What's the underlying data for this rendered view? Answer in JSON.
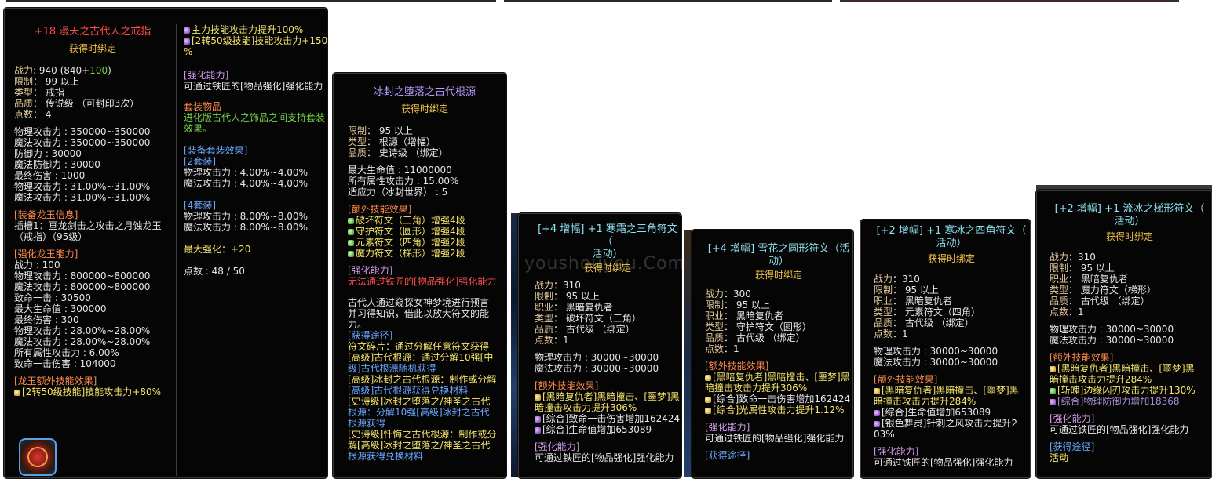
{
  "tooltip1": {
    "title": "+18 漫天之古代人之戒指",
    "bind": "获得时绑定",
    "basic": [
      {
        "k": "战力",
        "v": ": 940 (840+",
        "extra": "100",
        ")": ")"
      },
      {
        "k": "限制",
        "v": "：  99 以上"
      },
      {
        "k": "类型",
        "v": "：  戒指"
      },
      {
        "k": "品质",
        "v": "：  传说级           （可封印3次）"
      },
      {
        "k": "点数",
        "v": "：  4"
      }
    ],
    "stats": [
      "物理攻击力 : 350000~350000",
      "魔法攻击力 : 350000~350000",
      "防御力 : 30000",
      "魔法防御力 : 30000",
      "最终伤害 : 1000",
      "物理攻击力 : 31.00%~31.00%",
      "魔法攻击力 : 31.00%~31.00%"
    ],
    "gem_head": "[装备龙玉信息]",
    "gem_lines": [
      "插槽1：亘龙剑击之攻击之月蚀龙玉",
      "（戒指）（95级）"
    ],
    "enhance_head": "[强化龙玉能力]",
    "enhance_lines": [
      "战力 : 100",
      "物理攻击力 : 800000~800000",
      "魔法攻击力 : 800000~800000",
      "致命一击 : 30500",
      "最大生命值 :  300000",
      "最终伤害 : 300",
      "物理攻击力 : 28.00%~28.00%",
      "魔法攻击力 : 28.00%~28.00%",
      "所有属性攻击力 : 6.00%",
      "致命一击伤害 : 104000"
    ],
    "extra_head": "[龙玉额外技能效果]",
    "extra_line": "[2转50级技能]技能攻击力+80%",
    "right_top": [
      "主力技能攻击力提升100%",
      "[2转50级技能]技能攻击力+150",
      "%"
    ],
    "right_enh_head": "[强化能力]",
    "right_enh_line": "可通过铁匠的[物品强化]强化能力",
    "set_item_head": "套装物品",
    "set_item_desc": [
      "进化版古代人之饰品之间支持套装",
      "效果。"
    ],
    "set_effect_head": "[装备套装效果]",
    "set2_head": "[2套装]",
    "set2_lines": [
      "物理攻击力 : 4.00%~4.00%",
      "魔法攻击力 : 4.00%~4.00%"
    ],
    "set4_head": "[4套装]",
    "set4_lines": [
      "物理攻击力 : 8.00%~8.00%",
      "魔法攻击力 : 8.00%~8.00%"
    ],
    "max_enh": "最大强化：+20",
    "points": "点数 : 48 / 50"
  },
  "tooltip2": {
    "title": "冰封之堕落之古代根源",
    "bind": "获得时绑定",
    "basic": [
      {
        "k": "限制",
        "v": "：  95 以上"
      },
      {
        "k": "类型",
        "v": "：  根源（增幅）"
      },
      {
        "k": "品质",
        "v": "：  史诗级                    （绑定）"
      }
    ],
    "stats": [
      "最大生命值 :  11000000",
      "所有属性攻击力 : 15.00%",
      "适应力（冰封世界） : 5"
    ],
    "skill_head": "[额外技能效果]",
    "skills": [
      "破坏符文（三角）增强4段",
      "守护符文（圆形）增强4段",
      "元素符文（四角）增强2段",
      "魔力符文（梯形）增强2段"
    ],
    "enh_head": "[强化能力]",
    "enh_line": "无法通过铁匠的[物品强化]强化能力",
    "desc": [
      "古代人通过窥探女神梦境进行预言",
      "并习得知识，借此以放大符文的能",
      "力。"
    ],
    "route_head": "[获得途径]",
    "routes": [
      "符文碎片：通过分解任意符文获得",
      "[高级]古代根源：通过分解10强[中",
      "级]古代根源随机获得",
      "[高级]冰封之古代根源：制作或分解",
      "[高级]古代根源获得兑换材料",
      "[史诗级]冰封之堕落之/神圣之古代",
      "根源：分解10强[高级]冰封之古代",
      "根源获得",
      "[史诗级]忏悔之古代根源：制作或分",
      "解[高级]冰封之堕落之/神圣之古代",
      "根源获得兑换材料"
    ]
  },
  "tooltip3": {
    "title": [
      "[+4 增幅] +1  寒霜之三角符文（",
      "活动）"
    ],
    "bind": "获得时绑定",
    "basic": [
      {
        "k": "战力",
        "v": "：310"
      },
      {
        "k": "限制",
        "v": "：  95 以上"
      },
      {
        "k": "职业",
        "v": "：  黑暗复仇者"
      },
      {
        "k": "类型",
        "v": "：  破坏符文（三角）"
      },
      {
        "k": "品质",
        "v": "：  古代级                 （绑定）"
      },
      {
        "k": "点数",
        "v": "：1"
      }
    ],
    "stats": [
      "物理攻击力 : 30000~30000",
      "魔法攻击力 : 30000~30000"
    ],
    "skill_head": "[额外技能效果]",
    "skills": [
      "[黑暗复仇者]黑暗撞击、[噩梦]黑",
      "暗撞击攻击力提升306%",
      "[综合]致命一击伤害增加162424",
      "[综合]生命值增加653089"
    ],
    "enh_head": "[强化能力]",
    "enh_line": "可通过铁匠的[物品强化]强化能力"
  },
  "tooltip4": {
    "title": [
      "[+4 增幅] 雪花之圆形符文（活",
      "动）"
    ],
    "bind": "获得时绑定",
    "basic": [
      {
        "k": "战力",
        "v": "：300"
      },
      {
        "k": "限制",
        "v": "：  95 以上"
      },
      {
        "k": "职业",
        "v": "：  黑暗复仇者"
      },
      {
        "k": "类型",
        "v": "：  守护符文（圆形）"
      },
      {
        "k": "品质",
        "v": "：  古代级                 （绑定）"
      },
      {
        "k": "点数",
        "v": "：1"
      }
    ],
    "skill_head": "[额外技能效果]",
    "skills": [
      "[黑暗复仇者]黑暗撞击、[噩梦]黑",
      "暗撞击攻击力提升306%",
      "[综合]致命一击伤害增加162424",
      "[综合]光属性攻击力提升1.12%"
    ],
    "enh_head": "[强化能力]",
    "enh_line": "可通过铁匠的[物品强化]强化能力",
    "route_head": "[获得途径]"
  },
  "tooltip5": {
    "title": [
      "[+2 增幅] +1  寒冰之四角符文（",
      "活动）"
    ],
    "bind": "获得时绑定",
    "basic": [
      {
        "k": "战力",
        "v": "：310"
      },
      {
        "k": "限制",
        "v": "：  95 以上"
      },
      {
        "k": "职业",
        "v": "：  黑暗复仇者"
      },
      {
        "k": "类型",
        "v": "：  元素符文（四角）"
      },
      {
        "k": "品质",
        "v": "：  古代级                 （绑定）"
      },
      {
        "k": "点数",
        "v": "：1"
      }
    ],
    "stats": [
      "物理攻击力 : 30000~30000",
      "魔法攻击力 : 30000~30000"
    ],
    "skill_head": "[额外技能效果]",
    "skills": [
      "[黑暗复仇者]黑暗撞击、[噩梦]黑",
      "暗撞击攻击力提升284%",
      "[综合]生命值增加653089",
      "[银色舞灵]针刺之风攻击力提升2",
      "03%"
    ],
    "enh_head": "[强化能力]",
    "enh_line": "可通过铁匠的[物品强化]强化能力"
  },
  "tooltip6": {
    "title": [
      "[+2 增幅] +1  流冰之梯形符文（",
      "活动）"
    ],
    "bind": "获得时绑定",
    "basic": [
      {
        "k": "战力",
        "v": "：310"
      },
      {
        "k": "限制",
        "v": "：  95 以上"
      },
      {
        "k": "职业",
        "v": "：  黑暗复仇者"
      },
      {
        "k": "类型",
        "v": "：  魔力符文（梯形）"
      },
      {
        "k": "品质",
        "v": "：  古代级                 （绑定）"
      },
      {
        "k": "点数",
        "v": "：1"
      }
    ],
    "stats": [
      "物理攻击力 : 30000~30000",
      "魔法攻击力 : 30000~30000"
    ],
    "skill_head": "[额外技能效果]",
    "skills": [
      "[黑暗复仇者]黑暗撞击、[噩梦]黑",
      "暗撞击攻击力提升284%",
      "[斩魄]边缘闪刃攻击力提升130%",
      "[综合]物理防御力增加18368"
    ],
    "enh_head": "[强化能力]",
    "enh_line": "可通过铁匠的[物品强化]强化能力",
    "route_head": "[获得途径]",
    "route_line": "活动"
  },
  "watermark": "youshouyou.Com",
  "colors": {
    "title_red": "#ff4a4a",
    "bind": "#f3c24a",
    "key": "#e2c79b",
    "section": "#d19ae8",
    "blue": "#6aa7ff",
    "green": "#76d04a",
    "yellow": "#f5e46c",
    "rune_title": "#8fe0f0"
  }
}
